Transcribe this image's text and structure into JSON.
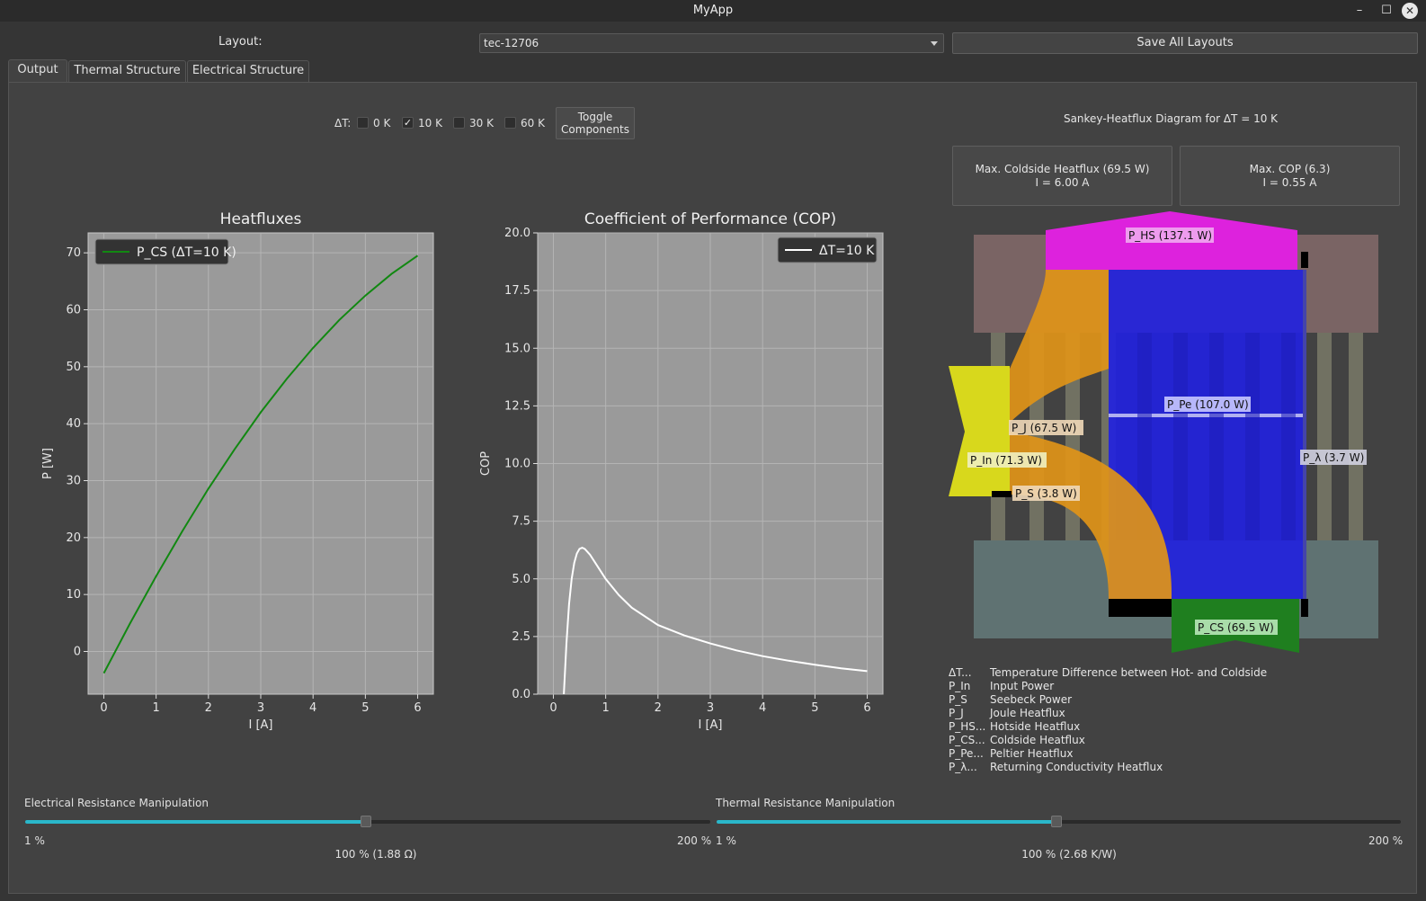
{
  "window": {
    "title": "MyApp"
  },
  "layout": {
    "label": "Layout:",
    "selected": "tec-12706",
    "save_label": "Save All Layouts"
  },
  "tabs": [
    {
      "label": "Output",
      "active": true
    },
    {
      "label": "Thermal Structure",
      "active": false
    },
    {
      "label": "Electrical Structure",
      "active": false
    }
  ],
  "delta_t": {
    "label": "ΔT:",
    "options": [
      {
        "label": "0 K",
        "checked": false
      },
      {
        "label": "10 K",
        "checked": true
      },
      {
        "label": "30 K",
        "checked": false
      },
      {
        "label": "60 K",
        "checked": false
      }
    ],
    "toggle_line1": "Toggle",
    "toggle_line2": "Components"
  },
  "sankey": {
    "title": "Sankey-Heatflux Diagram for ΔT = 10 K",
    "max_heatflux_line1": "Max. Coldside Heatflux (69.5 W)",
    "max_heatflux_line2": "I = 6.00 A",
    "max_cop_line1": "Max. COP (6.3)",
    "max_cop_line2": "I = 0.55 A",
    "labels": {
      "p_hs": "P_HS (137.1 W)",
      "p_pe": "P_Pe (107.0 W)",
      "p_j": "P_J (67.5 W)",
      "p_in": "P_In (71.3 W)",
      "p_lambda": "P_λ (3.7 W)",
      "p_s": "P_S (3.8 W)",
      "p_cs": "P_CS (69.5 W)"
    },
    "legend": [
      {
        "key": "ΔT...",
        "desc": "Temperature Difference between Hot- and Coldside"
      },
      {
        "key": "P_In",
        "desc": "Input Power"
      },
      {
        "key": "P_S",
        "desc": "Seebeck Power"
      },
      {
        "key": "P_J",
        "desc": "Joule Heatflux"
      },
      {
        "key": "P_HS...",
        "desc": "Hotside Heatflux"
      },
      {
        "key": "P_CS...",
        "desc": "Coldside Heatflux"
      },
      {
        "key": "P_Pe...",
        "desc": "Peltier Heatflux"
      },
      {
        "key": "P_λ...",
        "desc": "Returning Conductivity Heatflux"
      }
    ],
    "colors": {
      "hotside": "#dd22dd",
      "peltier": "#2222dd",
      "joule": "#e09418",
      "input": "#d8d81c",
      "coldside": "#1f7f1f"
    }
  },
  "sliders": {
    "electrical": {
      "title": "Electrical Resistance Manipulation",
      "min": "1 %",
      "max": "200 %",
      "value": "100 % (1.88 Ω)",
      "fraction": 0.497
    },
    "thermal": {
      "title": "Thermal Resistance Manipulation",
      "min": "1 %",
      "max": "200 %",
      "value": "100 % (2.68 K/W)",
      "fraction": 0.497
    }
  },
  "chart_data": [
    {
      "type": "line",
      "title": "Heatfluxes",
      "xlabel": "I [A]",
      "ylabel": "P [W]",
      "xlim": [
        -0.3,
        6.3
      ],
      "ylim": [
        -7.5,
        73.5
      ],
      "xticks": [
        0,
        1,
        2,
        3,
        4,
        5,
        6
      ],
      "yticks": [
        0,
        10,
        20,
        30,
        40,
        50,
        60,
        70
      ],
      "grid": true,
      "legend": "top-left",
      "series": [
        {
          "name": "P_CS (ΔT=10 K)",
          "color": "#118811",
          "x": [
            0,
            0.5,
            1,
            1.5,
            2,
            2.5,
            3,
            3.5,
            4,
            4.5,
            5,
            5.5,
            6
          ],
          "y": [
            -3.8,
            4.9,
            13.2,
            21.1,
            28.6,
            35.5,
            42.0,
            47.9,
            53.3,
            58.2,
            62.5,
            66.3,
            69.5
          ]
        }
      ]
    },
    {
      "type": "line",
      "title": "Coefficient of Performance (COP)",
      "xlabel": "I [A]",
      "ylabel": "COP",
      "xlim": [
        -0.3,
        6.3
      ],
      "ylim": [
        0,
        20
      ],
      "xticks": [
        0,
        1,
        2,
        3,
        4,
        5,
        6
      ],
      "yticks": [
        0.0,
        2.5,
        5.0,
        7.5,
        10.0,
        12.5,
        15.0,
        17.5,
        20.0
      ],
      "grid": true,
      "legend": "top-right",
      "series": [
        {
          "name": "ΔT=10 K",
          "color": "#ffffff",
          "x": [
            0.2,
            0.25,
            0.3,
            0.35,
            0.4,
            0.45,
            0.5,
            0.55,
            0.6,
            0.7,
            0.8,
            1.0,
            1.25,
            1.5,
            2.0,
            2.5,
            3.0,
            3.5,
            4.0,
            4.5,
            5.0,
            5.5,
            6.0
          ],
          "y": [
            0.0,
            2.2,
            3.9,
            5.0,
            5.7,
            6.1,
            6.3,
            6.35,
            6.3,
            6.05,
            5.7,
            5.0,
            4.3,
            3.75,
            3.0,
            2.55,
            2.2,
            1.9,
            1.65,
            1.45,
            1.28,
            1.12,
            1.0
          ]
        }
      ]
    }
  ]
}
